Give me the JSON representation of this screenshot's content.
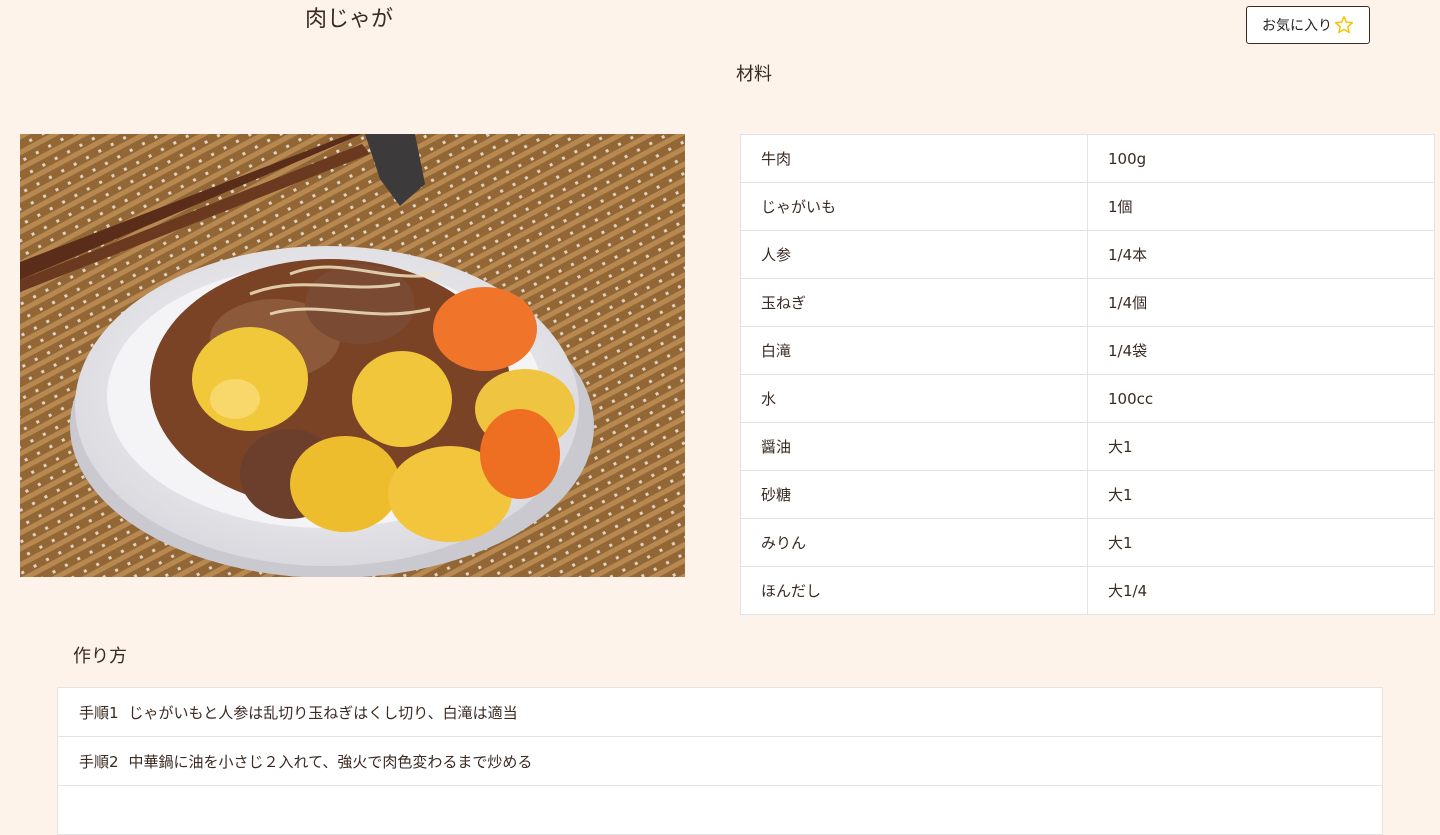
{
  "recipe": {
    "title": "肉じゃが",
    "favorite_label": "お気に入り",
    "favorite_icon": "star-icon",
    "star_color": "#f5c400"
  },
  "materials": {
    "heading": "材料",
    "rows": [
      {
        "name": "牛肉",
        "amount": "100g"
      },
      {
        "name": "じゃがいも",
        "amount": "1個"
      },
      {
        "name": "人参",
        "amount": "1/4本"
      },
      {
        "name": "玉ねぎ",
        "amount": "1/4個"
      },
      {
        "name": "白滝",
        "amount": "1/4袋"
      },
      {
        "name": "水",
        "amount": "100cc"
      },
      {
        "name": "醤油",
        "amount": "大1"
      },
      {
        "name": "砂糖",
        "amount": "大1"
      },
      {
        "name": "みりん",
        "amount": "大1"
      },
      {
        "name": "ほんだし",
        "amount": "大1/4"
      }
    ]
  },
  "howto": {
    "heading": "作り方",
    "steps": [
      {
        "label": "手順1",
        "text": "じゃがいもと人参は乱切り玉ねぎはくし切り、白滝は適当"
      },
      {
        "label": "手順2",
        "text": "中華鍋に油を小さじ２入れて、強火で肉色変わるまで炒める"
      },
      {
        "label": "",
        "text": ""
      }
    ]
  }
}
